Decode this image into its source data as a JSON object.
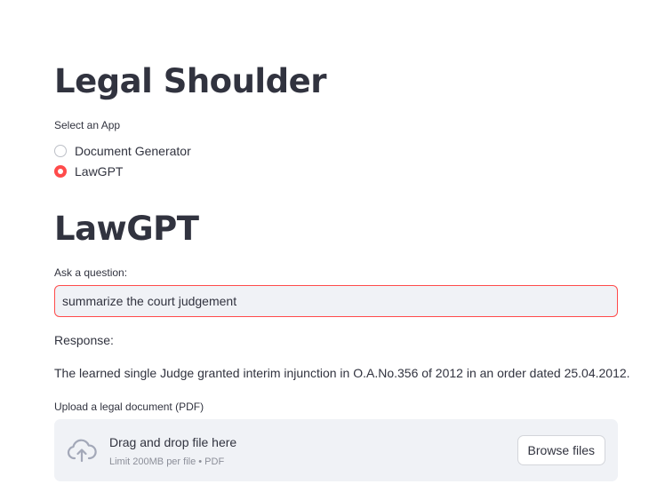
{
  "header": {
    "title": "Legal Shoulder"
  },
  "app_selector": {
    "label": "Select an App",
    "options": [
      {
        "label": "Document Generator",
        "selected": false
      },
      {
        "label": "LawGPT",
        "selected": true
      }
    ]
  },
  "section": {
    "title": "LawGPT"
  },
  "question": {
    "label": "Ask a question:",
    "value": "summarize the court judgement"
  },
  "response": {
    "label": "Response:",
    "text": "The learned single Judge granted interim injunction in O.A.No.356 of 2012 in an order dated 25.04.2012."
  },
  "upload": {
    "label": "Upload a legal document (PDF)",
    "drop_text": "Drag and drop file here",
    "limit_text": "Limit 200MB per file • PDF",
    "browse_label": "Browse files",
    "icon": "cloud-upload-icon"
  },
  "colors": {
    "accent": "#ff4b4b",
    "text": "#31333f",
    "input_bg": "#f0f2f6",
    "muted": "#8c8f99"
  }
}
